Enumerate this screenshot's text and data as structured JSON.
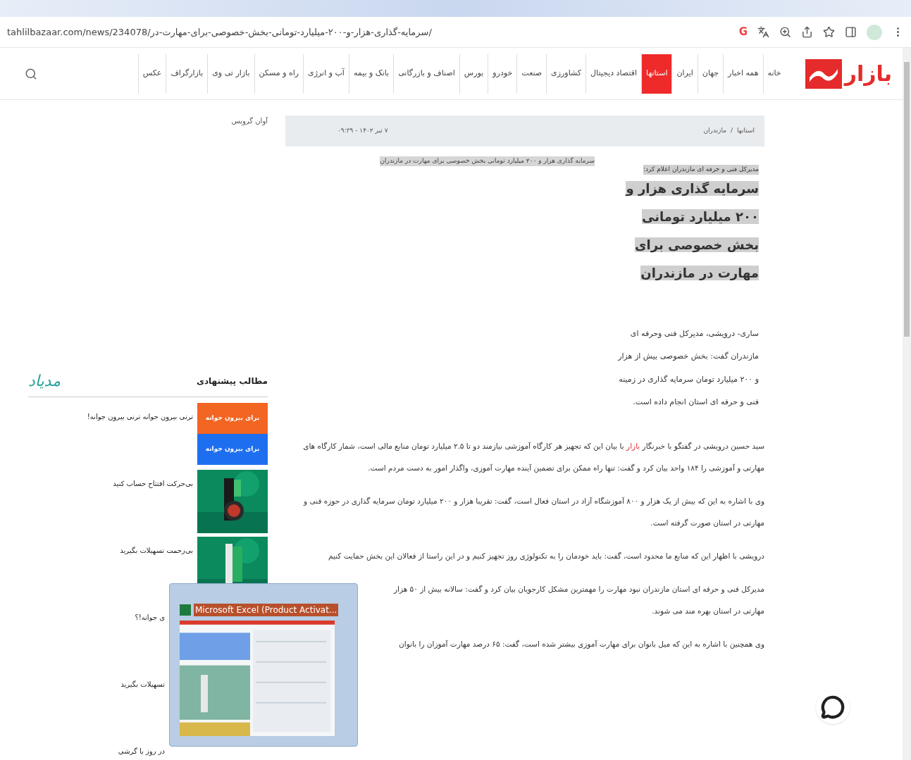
{
  "browser": {
    "url": "tahlilbazaar.com/news/234078/سرمایه-گذاری-هزار-و-۲۰۰-میلیارد-تومانی-بخش-خصوصی-برای-مهارت-در/",
    "extension_letter": "G"
  },
  "site": {
    "logo": "بازار",
    "nav": [
      {
        "label": "خانه",
        "selected": false
      },
      {
        "label": "همه اخبار",
        "selected": false
      },
      {
        "label": "جهان",
        "selected": false
      },
      {
        "label": "ایران",
        "selected": false
      },
      {
        "label": "استانها",
        "selected": true
      },
      {
        "label": "اقتصاد دیجیتال",
        "selected": false
      },
      {
        "label": "کشاورزی",
        "selected": false
      },
      {
        "label": "صنعت",
        "selected": false
      },
      {
        "label": "خودرو",
        "selected": false
      },
      {
        "label": "بورس",
        "selected": false
      },
      {
        "label": "اصناف و بازرگانی",
        "selected": false
      },
      {
        "label": "بانک و بیمه",
        "selected": false
      },
      {
        "label": "آب و انرژی",
        "selected": false
      },
      {
        "label": "راه و مسکن",
        "selected": false
      },
      {
        "label": "بازار تی وی",
        "selected": false
      },
      {
        "label": "بازارگراف",
        "selected": false
      },
      {
        "label": "عکس",
        "selected": false
      }
    ]
  },
  "ad": {
    "alt": "آوان گروپس"
  },
  "breadcrumb": {
    "items": [
      "استانها",
      "مازندران"
    ],
    "separator": "/",
    "date": "۷ تیر ۱۴۰۲ - ۰۹:۳۹"
  },
  "article": {
    "lead": "مدیرکل فنی و حرفه ای مازندران اعلام کرد:",
    "title": "سرمایه گذاری هزار و ۲۰۰ میلیارد تومانی بخش خصوصی برای مهارت در مازندران",
    "image_alt": "سرمایه گذاری هزار و ۲۰۰ میلیارد تومانی بخش خصوصی برای مهارت در مازندران",
    "summary": "ساری- درویشی، مدیرکل فنی وحرفه ای مازندران گفت: بخش خصوصی بیش از هزار و ۲۰۰ میلیارد تومان سرمایه گذاری در زمینه فنی و حرفه ای استان انجام داده است.",
    "paragraphs": [
      {
        "parts": [
          {
            "kind": "text",
            "text": "سید حسین درویشی در گفتگو با خبرنگار "
          },
          {
            "kind": "link",
            "text": "بازار"
          },
          {
            "kind": "text",
            "text": " با بیان این که تجهیز هر کارگاه آموزشی نیازمند دو تا ۲.۵ میلیارد تومان منابع مالی است، شمار کارگاه های مهارتی و آموزشی را ۱۸۴ واحد بیان کرد و گفت: تنها راه ممکن برای تضمین آینده مهارت آموزی، واگذار امور به دست مردم است."
          }
        ]
      },
      {
        "parts": [
          {
            "kind": "text",
            "text": "وی با اشاره به این که بیش از یک هزار و ۸۰۰ آموزشگاه آزاد در استان فعال است، گفت: تقریبا هزار و ۲۰۰ میلیارد تومان سرمایه گذاری در حوزه فنی و مهارتی در استان صورت گرفته است."
          }
        ]
      },
      {
        "parts": [
          {
            "kind": "text",
            "text": "درویشی با اظهار این که منابع ما محدود است، گفت: باید خودمان را به تکنولوژی روز تجهیز کنیم و در این راستا از فعالان این بخش حمایت کنیم"
          }
        ]
      },
      {
        "parts": [
          {
            "kind": "text",
            "text": "مدیرکل فنی و حرفه ای استان مازندران نبود مهارت را مهمترین مشکل کارجویان بیان کرد و گفت: سالانه بیش از ۵۰ هزار"
          }
        ],
        "tail": "مهارتی در استان بهره مند می شوند."
      },
      {
        "parts": [
          {
            "kind": "text",
            "text": "وی همچنین با اشاره به این که میل بانوان برای مهارت آموزی بیشتر شده است، گفت: ۶۵ درصد مهارت آموزان را بانوان"
          }
        ]
      }
    ]
  },
  "sidebar": {
    "heading": "مطالب پیشنهادی",
    "logo": "مدیاد",
    "items": [
      {
        "kind": "banner",
        "caption": "ترنی بیرون جوانه ترنی بیرون جوانه!",
        "banners": [
          {
            "text": "برای بیرون جوانه",
            "color": "#f26522"
          },
          {
            "text": "برای بیرون جوانه",
            "color": "#1e6ff0"
          }
        ]
      },
      {
        "kind": "picture",
        "caption": "بی‌حرکت افتتاح حساب کنید"
      },
      {
        "kind": "picture",
        "caption": "بی‌زحمت تسهیلات بگیرید"
      },
      {
        "kind": "covered",
        "caption": "ی جوانه!؟"
      },
      {
        "kind": "covered",
        "caption": "تسهیلات بگیرید"
      },
      {
        "kind": "covered",
        "caption": "در روز با گرشی"
      }
    ]
  },
  "taskbar_preview": {
    "title": "Microsoft Excel (Product Activat..."
  }
}
